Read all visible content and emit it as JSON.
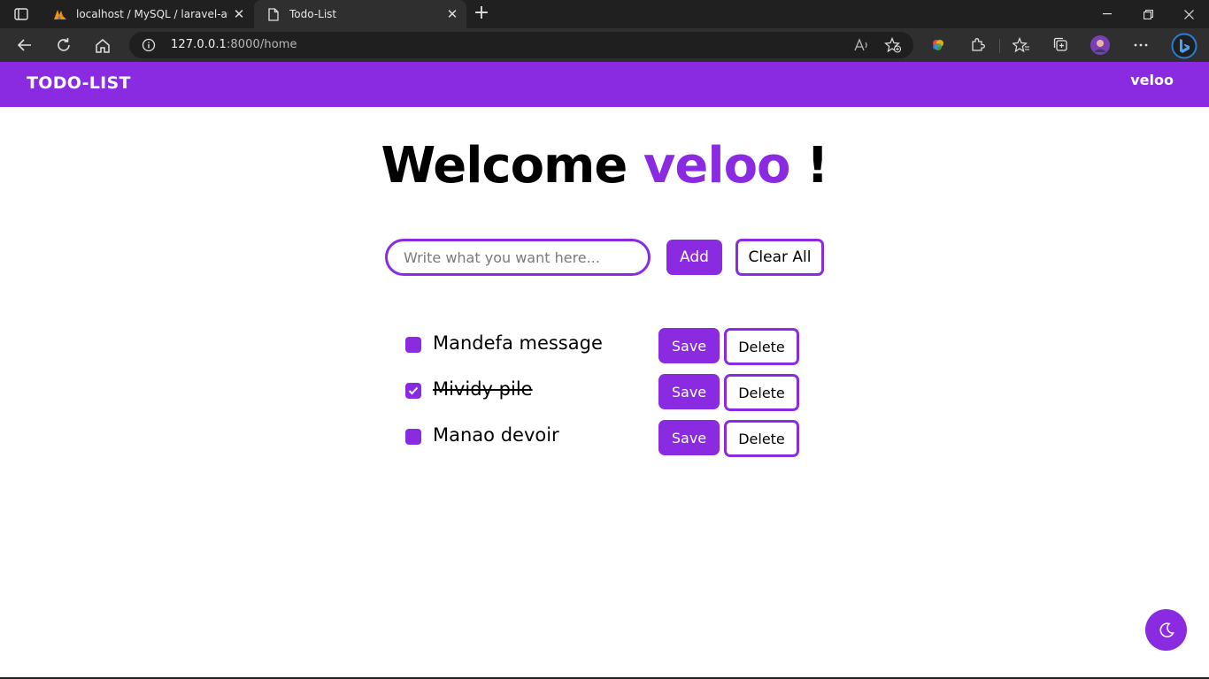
{
  "browser": {
    "tabs": [
      {
        "title": "localhost / MySQL / laravel-auth",
        "active": false,
        "icon": "phpmyadmin-icon"
      },
      {
        "title": "Todo-List",
        "active": true,
        "icon": "page-icon"
      }
    ],
    "address": {
      "host": "127.0.0.1",
      "rest": ":8000/home"
    }
  },
  "header": {
    "brand": "TODO-LIST",
    "user": "veloo"
  },
  "main": {
    "welcome_prefix": "Welcome",
    "welcome_name": "veloo",
    "welcome_suffix": "!",
    "input_placeholder": "Write what you want here...",
    "add_label": "Add",
    "clear_label": "Clear All",
    "todos": [
      {
        "text": "Mandefa message",
        "done": false,
        "save_label": "Save",
        "delete_label": "Delete"
      },
      {
        "text": "Mividy pile",
        "done": true,
        "save_label": "Save",
        "delete_label": "Delete"
      },
      {
        "text": "Manao devoir",
        "done": false,
        "save_label": "Save",
        "delete_label": "Delete"
      }
    ]
  },
  "colors": {
    "accent": "#8a2be2",
    "chrome_dark": "#202020",
    "chrome_mid": "#2f2f2f"
  },
  "theme_toggle": {
    "icon": "moon-icon"
  }
}
